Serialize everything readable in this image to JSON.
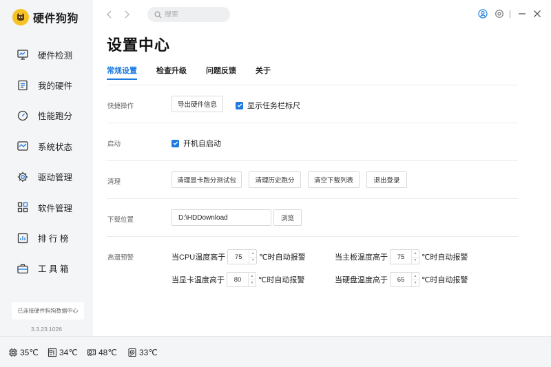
{
  "app": {
    "name": "硬件狗狗",
    "version": "3.3.23.1026",
    "connection_status": "已连接硬件狗狗数据中心"
  },
  "colors": {
    "accent": "#1d7be0",
    "logo": "#f6c224"
  },
  "sidebar": {
    "items": [
      {
        "label": "硬件检测",
        "icon": "monitor-icon"
      },
      {
        "label": "我的硬件",
        "icon": "hardware-list-icon"
      },
      {
        "label": "性能跑分",
        "icon": "speedometer-icon"
      },
      {
        "label": "系统状态",
        "icon": "system-status-icon"
      },
      {
        "label": "驱动管理",
        "icon": "gear-icon"
      },
      {
        "label": "软件管理",
        "icon": "apps-grid-icon"
      },
      {
        "label": "排 行 榜",
        "icon": "ranking-icon"
      },
      {
        "label": "工 具 箱",
        "icon": "toolbox-icon"
      }
    ]
  },
  "topbar": {
    "search_placeholder": "搜索"
  },
  "page": {
    "title": "设置中心",
    "tabs": [
      {
        "label": "常规设置",
        "active": true
      },
      {
        "label": "检查升级",
        "active": false
      },
      {
        "label": "问题反馈",
        "active": false
      },
      {
        "label": "关于",
        "active": false
      }
    ]
  },
  "settings": {
    "quick": {
      "label": "快捷操作",
      "export_button": "导出硬件信息",
      "taskbar_ruler": {
        "label": "显示任务栏标尺",
        "checked": true
      }
    },
    "startup": {
      "label": "启动",
      "autostart": {
        "label": "开机自启动",
        "checked": true
      }
    },
    "cleanup": {
      "label": "清理",
      "buttons": [
        "清理显卡跑分测试包",
        "清理历史跑分",
        "清空下载列表",
        "退出登录"
      ]
    },
    "download": {
      "label": "下载位置",
      "path": "D:\\HDDownload",
      "browse_button": "浏览"
    },
    "alerts": {
      "label": "高温预警",
      "suffix": "℃时自动报警",
      "cpu": {
        "label": "当CPU温度高于",
        "value": "75"
      },
      "board": {
        "label": "当主板温度高于",
        "value": "75"
      },
      "gpu": {
        "label": "当显卡温度高于",
        "value": "80"
      },
      "disk": {
        "label": "当硬盘温度高于",
        "value": "65"
      }
    }
  },
  "statusbar": {
    "cpu_temp": "35℃",
    "board_temp": "34℃",
    "gpu_temp": "48℃",
    "disk_temp": "33℃"
  }
}
